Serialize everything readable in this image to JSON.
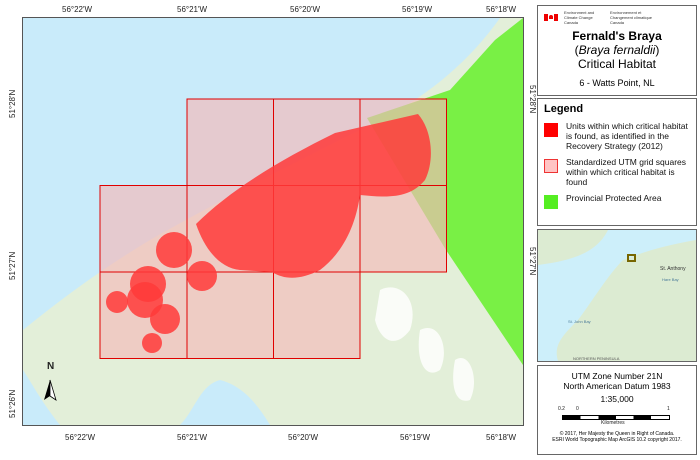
{
  "map": {
    "top_ticks": [
      "56°22'W",
      "56°21'W",
      "56°20'W",
      "56°19'W",
      "56°18'W"
    ],
    "bottom_ticks": [
      "56°22'W",
      "56°21'W",
      "56°20'W",
      "56°19'W",
      "56°18'W"
    ],
    "left_ticks": [
      "51°28'N",
      "51°27'N",
      "51°26'N"
    ],
    "right_ticks": [
      "51°28'N",
      "51°27'N"
    ],
    "north_label": "N",
    "colors": {
      "water": "#c9ebfa",
      "land": "#e3efd9",
      "critical_habitat": "#ff3a3a",
      "grid_square": "#f5b8b8",
      "protected_area": "#66f02a"
    }
  },
  "title_panel": {
    "agency_en": "Environment and Climate Change Canada",
    "agency_fr": "Environnement et Changement climatique Canada",
    "title": "Fernald's Braya",
    "scientific": "Braya fernaldii",
    "subtitle": "Critical Habitat",
    "location": "6 - Watts Point, NL"
  },
  "legend": {
    "heading": "Legend",
    "items": [
      {
        "label": "Units within which critical habitat is found, as identified in the Recovery Strategy (2012)",
        "color": "#ff0000"
      },
      {
        "label": "Standardized UTM grid squares within which critical habitat is found",
        "color": "#ffc4c4"
      },
      {
        "label": "Provincial Protected Area",
        "color": "#55ee22"
      }
    ]
  },
  "inset": {
    "labels": [
      "St. Anthony",
      "Hare Bay",
      "St. John Bay",
      "NORTHERN PENINSULA"
    ]
  },
  "info": {
    "utm": "UTM Zone Number 21N",
    "datum": "North American Datum 1983",
    "scale": "1:35,000",
    "scale_ticks": [
      "0.2",
      "0",
      "1"
    ],
    "scale_unit": "Kilometres",
    "copyright1": "© 2017, Her Majesty the Queen in Right of Canada.",
    "copyright2": "ESRI World Topographic Map ArcGIS 10.2 copyright 2017."
  }
}
